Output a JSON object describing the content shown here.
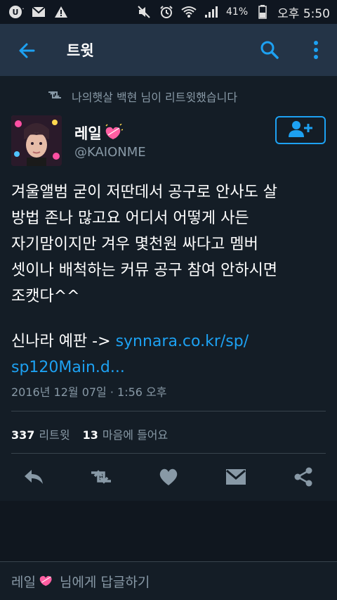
{
  "status_bar": {
    "battery_percent": "41%",
    "time_label": "오후 5:50"
  },
  "app_bar": {
    "title": "트윗"
  },
  "retweet_info": {
    "text": "나의햇살 백현 님이 리트윗했습니다"
  },
  "tweet": {
    "author_name": "레일",
    "author_handle": "@KAIONME",
    "body": "겨울앨범 굳이 저딴데서 공구로 안사도 살\n방법 존나 많고요 어디서 어떻게 사든\n자기맘이지만 겨우 몇천원 싸다고 멤버\n셋이나 배척하는 커뮤 공구 참여 안하시면\n조캣다^^",
    "source_label": "신나라 예판 ->",
    "link_line1": "synnara.co.kr/sp/",
    "link_line2": "sp120Main.d...",
    "timestamp": "2016년 12월 07일 · 1:56 오후",
    "retweet_count": "337",
    "retweet_label": "리트윗",
    "like_count": "13",
    "like_label": "마음에 들어요"
  },
  "reply_bar": {
    "name": "레일",
    "suffix": "님에게 답글하기"
  },
  "colors": {
    "background": "#141d26",
    "app_bar": "#243447",
    "accent": "#1da1f2",
    "secondary_text": "#8899a6",
    "divider": "#38444d"
  },
  "icons": {
    "back": "arrow-left-icon",
    "search": "search-icon",
    "more": "more-vertical-icon",
    "retweet": "retweet-icon",
    "follow": "add-user-icon",
    "heart_emoji": "sparkling-heart-icon",
    "reply": "reply-icon",
    "like": "heart-icon",
    "message": "envelope-icon",
    "share": "share-icon"
  }
}
